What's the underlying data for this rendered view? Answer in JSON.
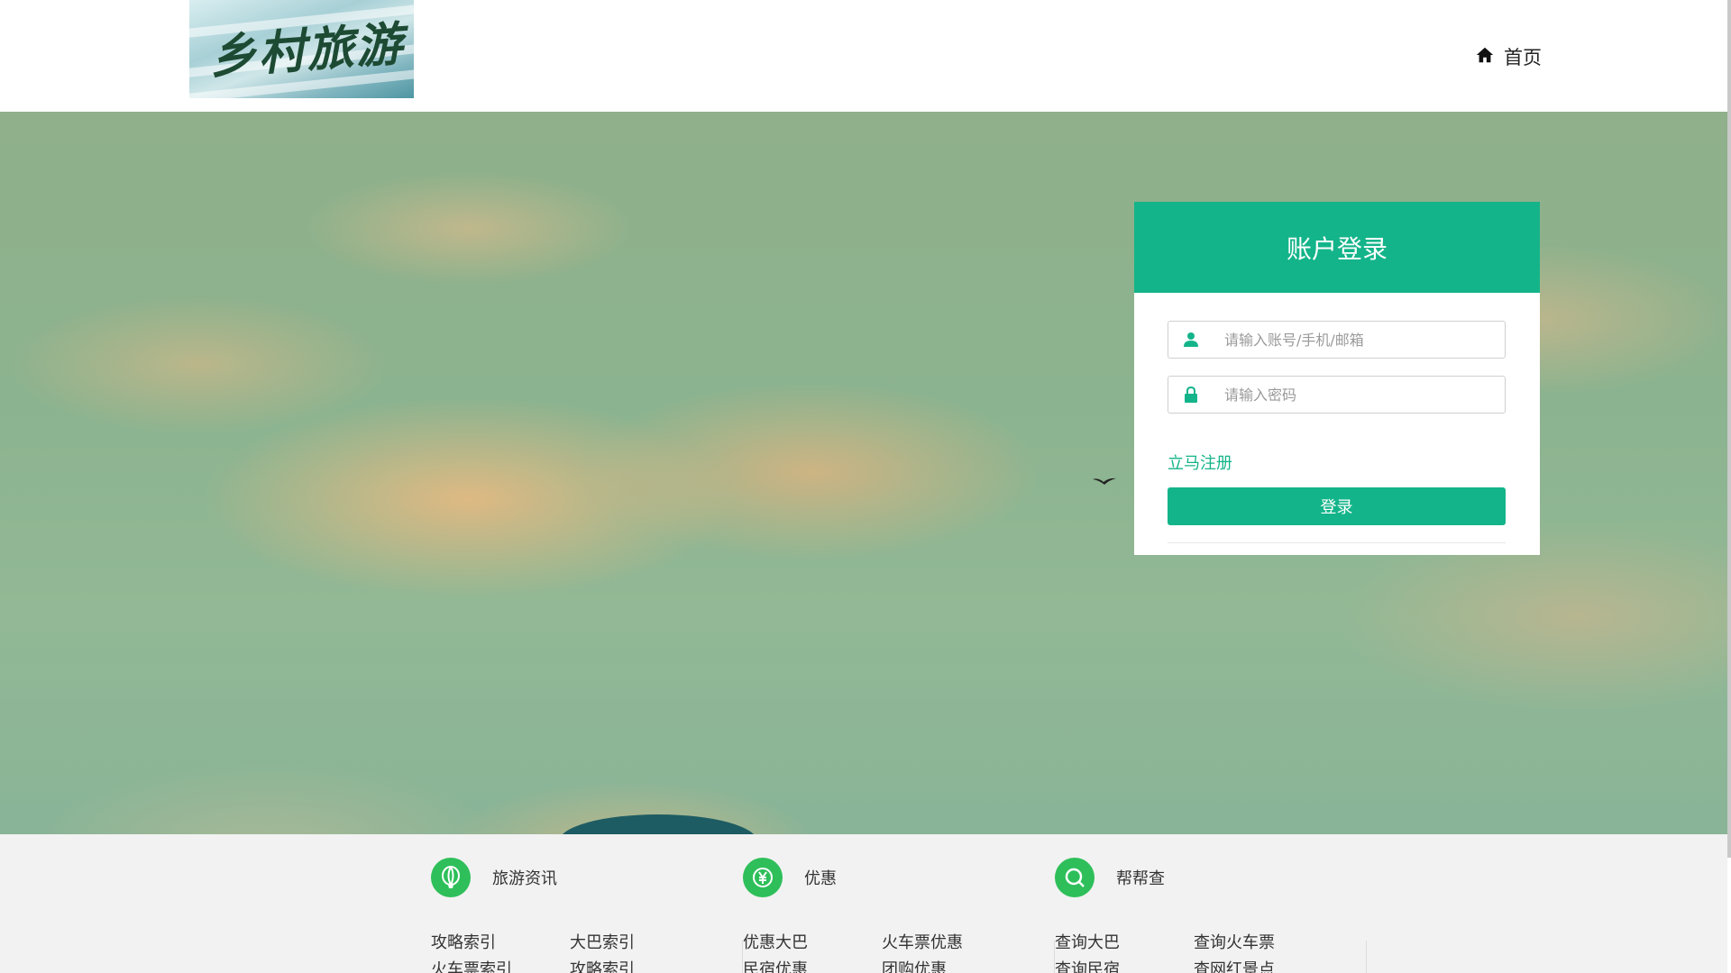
{
  "header": {
    "logo_text": "乡村旅游",
    "nav_home": "首页"
  },
  "login": {
    "title": "账户登录",
    "username_placeholder": "请输入账号/手机/邮箱",
    "password_placeholder": "请输入密码",
    "register_link": "立马注册",
    "submit_label": "登录"
  },
  "colors": {
    "accent": "#14b48a",
    "footer_icon": "#2ebf5a",
    "footer_bg": "#f2f2f2"
  },
  "footer": {
    "columns": [
      {
        "icon": "balloon-icon",
        "title": "旅游资讯",
        "links": [
          "攻略索引",
          "大巴索引",
          "火车票索引",
          "攻略索引"
        ]
      },
      {
        "icon": "yen-icon",
        "title": "优惠",
        "links": [
          "优惠大巴",
          "火车票优惠",
          "民宿优惠",
          "团购优惠"
        ]
      },
      {
        "icon": "search-icon",
        "title": "帮帮查",
        "links": [
          "查询大巴",
          "查询火车票",
          "查询民宿",
          "查网红景点"
        ]
      }
    ]
  }
}
